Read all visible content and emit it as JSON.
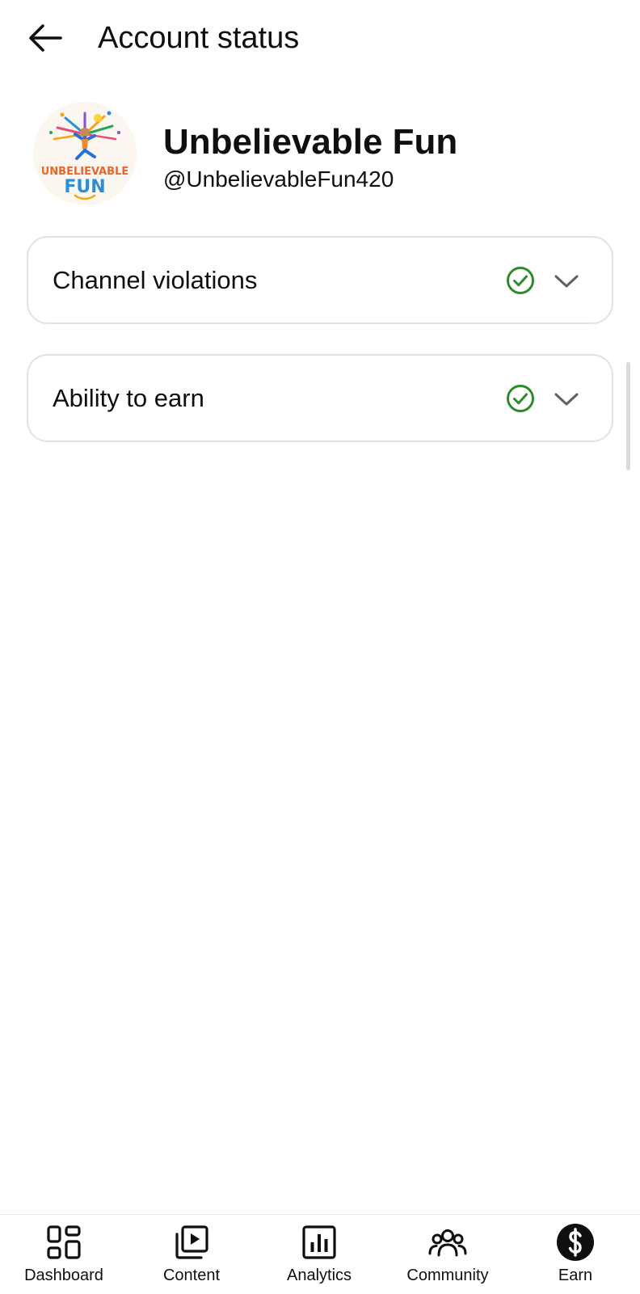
{
  "header": {
    "title": "Account status",
    "back_icon": "arrow-left-icon"
  },
  "channel": {
    "name": "Unbelievable Fun",
    "handle": "@UnbelievableFun420",
    "avatar_text_line1": "UNBELIEVABLE",
    "avatar_text_line2": "FUN"
  },
  "status_items": [
    {
      "label": "Channel violations",
      "status_icon": "check-circle-icon",
      "status_color": "#2e8b2e",
      "expand_icon": "chevron-down-icon"
    },
    {
      "label": "Ability to earn",
      "status_icon": "check-circle-icon",
      "status_color": "#2e8b2e",
      "expand_icon": "chevron-down-icon"
    }
  ],
  "bottom_nav": {
    "items": [
      {
        "label": "Dashboard",
        "icon": "dashboard-icon",
        "active": false
      },
      {
        "label": "Content",
        "icon": "content-icon",
        "active": false
      },
      {
        "label": "Analytics",
        "icon": "analytics-icon",
        "active": false
      },
      {
        "label": "Community",
        "icon": "community-icon",
        "active": false
      },
      {
        "label": "Earn",
        "icon": "earn-icon",
        "active": true
      }
    ]
  }
}
